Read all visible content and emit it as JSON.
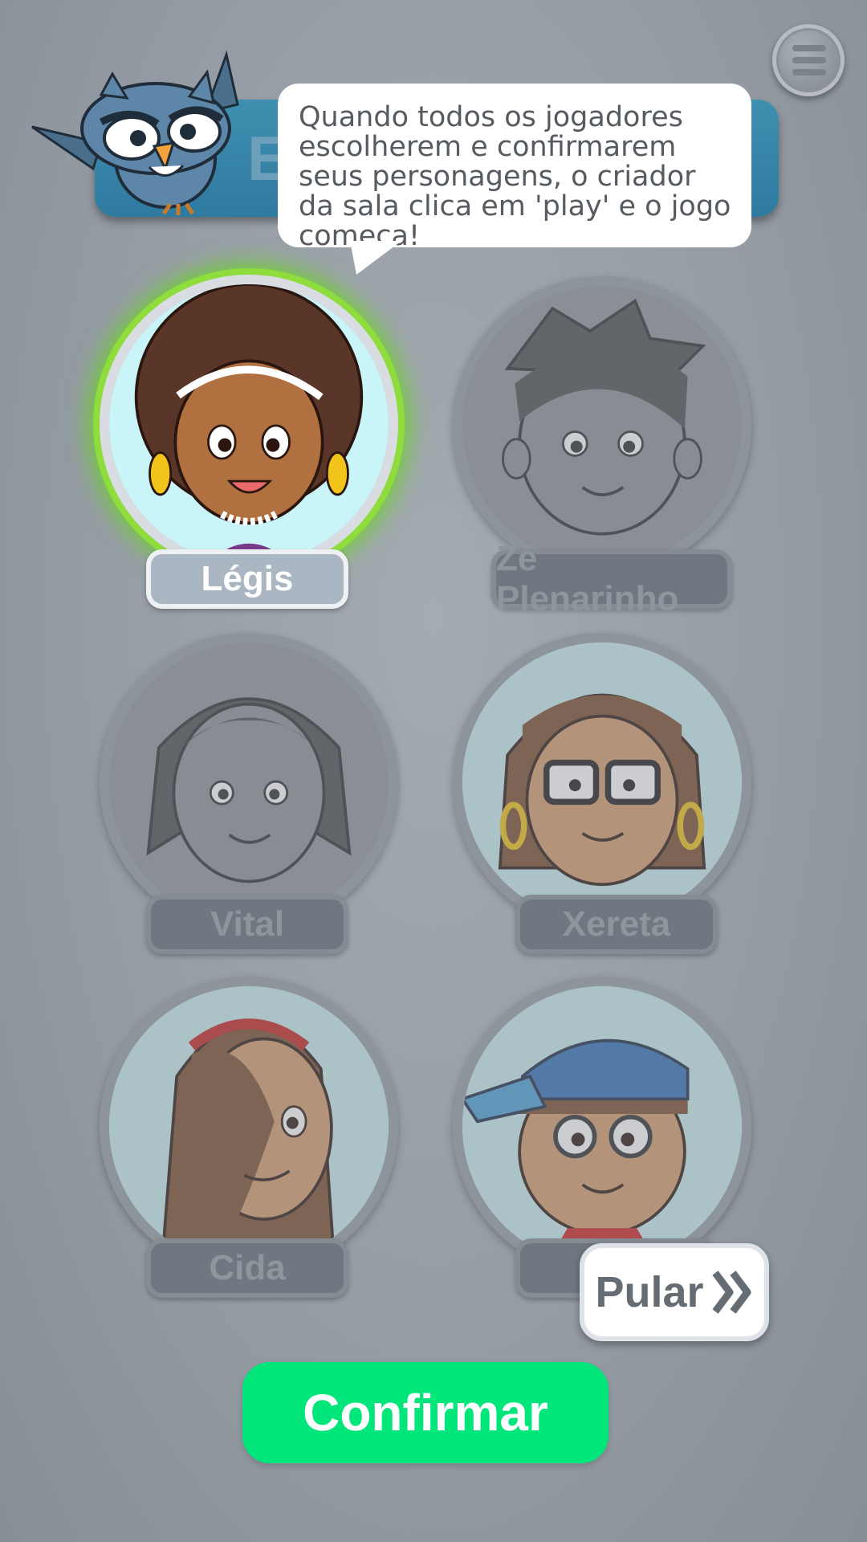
{
  "header": {
    "title_visible_fragment": "E",
    "menu_icon": "hamburger-menu-icon",
    "mascot_icon": "owl-mascot-icon"
  },
  "tooltip": {
    "text": "Quando todos os jogadores escolherem e confirmarem seus personagens, o criador da sala clica em 'play' e o jogo começa!"
  },
  "characters": [
    {
      "name": "Légis",
      "selected": true
    },
    {
      "name": "Zé Plenarinho",
      "selected": false
    },
    {
      "name": "Vital",
      "selected": false
    },
    {
      "name": "Xereta",
      "selected": false
    },
    {
      "name": "Cida",
      "selected": false
    },
    {
      "name": "",
      "selected": false
    }
  ],
  "buttons": {
    "skip_label": "Pular",
    "skip_icon": "double-chevron-right-icon",
    "confirm_label": "Confirmar"
  },
  "colors": {
    "confirm": "#00e67a",
    "selected_glow": "#6dd22a",
    "banner": "#2f7aa0"
  }
}
